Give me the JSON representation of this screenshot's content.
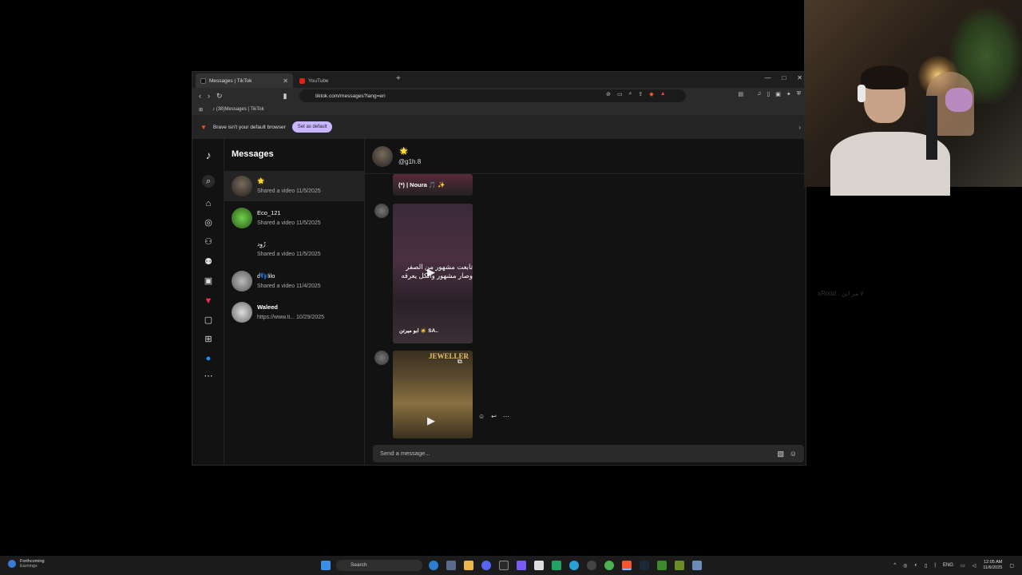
{
  "browser": {
    "tabs": [
      {
        "label": "Messages | TikTok",
        "active": true
      },
      {
        "label": "YouTube",
        "active": false
      }
    ],
    "url": "tiktok.com/messages?lang=en",
    "bookmark": "(38)Messages | TikTok",
    "infobar": {
      "text": "Brave isn't your default browser",
      "button": "Set as default"
    }
  },
  "tiktok": {
    "inbox_title": "Messages",
    "conversations": [
      {
        "name": "🌟",
        "preview": "Shared a video",
        "date": "11/5/2025",
        "selected": true
      },
      {
        "name": "Eco_121",
        "preview": "Shared a video",
        "date": "11/5/2025"
      },
      {
        "name": "رُوِد",
        "preview": "Shared a video",
        "date": "11/5/2025"
      },
      {
        "name": "ძ👣lilo",
        "preview": "Shared a video",
        "date": "11/4/2025"
      },
      {
        "name": "Waleed",
        "preview": "https://www.ti...",
        "date": "10/29/2025"
      }
    ],
    "chat": {
      "contact_emoji": "🌟",
      "handle": "@g1h.8",
      "video1_caption": "(*) | Noura 🎵 ✨",
      "video2_overlay_line1": "تابعت مشهور من الصفر",
      "video2_overlay_line2": "وصار مشهور والكل يعرفه",
      "video2_author": "ابو ميرتن 🧔 SA..",
      "video3_sign": "JEWELLER",
      "composer_placeholder": "Send a message..."
    }
  },
  "overlay_text": "xRoud : ٧ مر ابن",
  "taskbar": {
    "widget_title": "Forthcoming",
    "widget_sub": "Earnings",
    "search": "Search",
    "lang": "ENG",
    "time": "12:05 AM",
    "date": "11/6/2025"
  }
}
